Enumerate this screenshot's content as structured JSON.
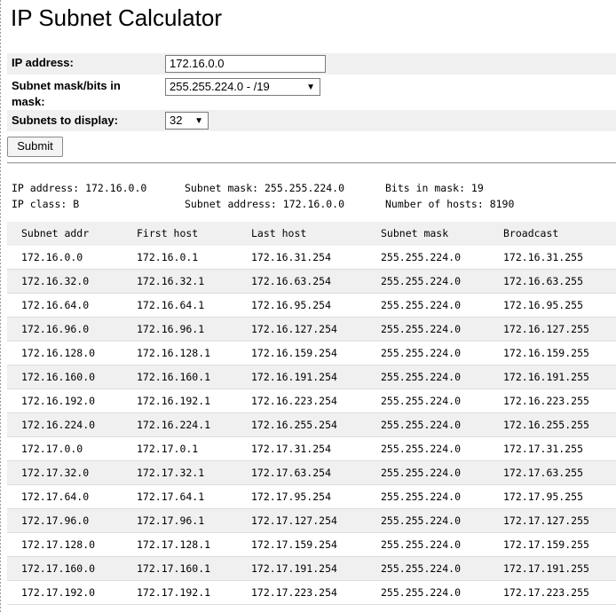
{
  "page": {
    "title": "IP Subnet Calculator"
  },
  "form": {
    "ip_label": "IP address:",
    "ip_value": "172.16.0.0",
    "mask_label": "Subnet mask/bits in mask:",
    "mask_value": "255.255.224.0 - /19",
    "subnets_label": "Subnets to display:",
    "subnets_value": "32",
    "submit_label": "Submit"
  },
  "summary": {
    "ip_address": "IP address: 172.16.0.0",
    "ip_class": "IP class: B",
    "subnet_mask": "Subnet mask: 255.255.224.0",
    "subnet_address": "Subnet address: 172.16.0.0",
    "bits_in_mask": "Bits in mask: 19",
    "number_of_hosts": "Number of hosts: 8190"
  },
  "table": {
    "headers": [
      "Subnet addr",
      "First host",
      "Last host",
      "Subnet mask",
      "Broadcast"
    ],
    "rows": [
      [
        "172.16.0.0",
        "172.16.0.1",
        "172.16.31.254",
        "255.255.224.0",
        "172.16.31.255"
      ],
      [
        "172.16.32.0",
        "172.16.32.1",
        "172.16.63.254",
        "255.255.224.0",
        "172.16.63.255"
      ],
      [
        "172.16.64.0",
        "172.16.64.1",
        "172.16.95.254",
        "255.255.224.0",
        "172.16.95.255"
      ],
      [
        "172.16.96.0",
        "172.16.96.1",
        "172.16.127.254",
        "255.255.224.0",
        "172.16.127.255"
      ],
      [
        "172.16.128.0",
        "172.16.128.1",
        "172.16.159.254",
        "255.255.224.0",
        "172.16.159.255"
      ],
      [
        "172.16.160.0",
        "172.16.160.1",
        "172.16.191.254",
        "255.255.224.0",
        "172.16.191.255"
      ],
      [
        "172.16.192.0",
        "172.16.192.1",
        "172.16.223.254",
        "255.255.224.0",
        "172.16.223.255"
      ],
      [
        "172.16.224.0",
        "172.16.224.1",
        "172.16.255.254",
        "255.255.224.0",
        "172.16.255.255"
      ],
      [
        "172.17.0.0",
        "172.17.0.1",
        "172.17.31.254",
        "255.255.224.0",
        "172.17.31.255"
      ],
      [
        "172.17.32.0",
        "172.17.32.1",
        "172.17.63.254",
        "255.255.224.0",
        "172.17.63.255"
      ],
      [
        "172.17.64.0",
        "172.17.64.1",
        "172.17.95.254",
        "255.255.224.0",
        "172.17.95.255"
      ],
      [
        "172.17.96.0",
        "172.17.96.1",
        "172.17.127.254",
        "255.255.224.0",
        "172.17.127.255"
      ],
      [
        "172.17.128.0",
        "172.17.128.1",
        "172.17.159.254",
        "255.255.224.0",
        "172.17.159.255"
      ],
      [
        "172.17.160.0",
        "172.17.160.1",
        "172.17.191.254",
        "255.255.224.0",
        "172.17.191.255"
      ],
      [
        "172.17.192.0",
        "172.17.192.1",
        "172.17.223.254",
        "255.255.224.0",
        "172.17.223.255"
      ]
    ]
  }
}
